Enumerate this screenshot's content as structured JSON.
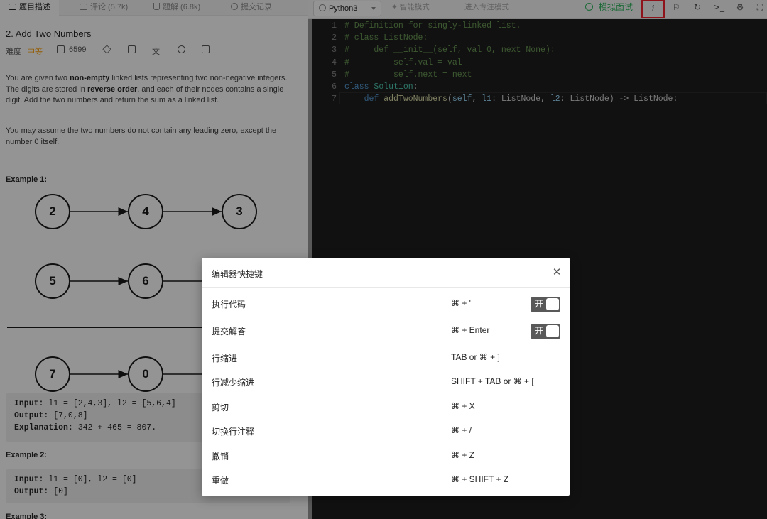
{
  "left_tabs": [
    {
      "label": "题目描述",
      "icon": "description-icon"
    },
    {
      "label": "评论 (5.7k)",
      "icon": "comment-icon"
    },
    {
      "label": "题解 (6.8k)",
      "icon": "flask-icon"
    },
    {
      "label": "提交记录",
      "icon": "history-icon"
    }
  ],
  "problem": {
    "title": "2. Add Two Numbers",
    "difficulty_label": "难度",
    "difficulty": "中等",
    "likes": "6599",
    "para1": {
      "t1": "You are given two ",
      "b1": "non-empty",
      "t2": " linked lists representing two non-negative integers. The digits are stored in ",
      "b2": "reverse order",
      "t3": ", and each of their nodes contains a single digit. Add the two numbers and return the sum as a linked list."
    },
    "para2": "You may assume the two numbers do not contain any leading zero, except the number 0 itself.",
    "example1_label": "Example 1:",
    "diagram_rows": [
      [
        "2",
        "4",
        "3"
      ],
      [
        "5",
        "6"
      ],
      [
        "7",
        "0"
      ]
    ],
    "example1": {
      "input_label": "Input:",
      "input_value": " l1 = [2,4,3], l2 = [5,6,4]",
      "output_label": "Output:",
      "output_value": " [7,0,8]",
      "explanation_label": "Explanation:",
      "explanation_value": " 342 + 465 = 807."
    },
    "example2_label": "Example 2:",
    "example2": {
      "input_label": "Input:",
      "input_value": " l1 = [0], l2 = [0]",
      "output_label": "Output:",
      "output_value": " [0]"
    },
    "example3_label": "Example 3:"
  },
  "toolbar": {
    "language": "Python3",
    "smart_mode": "智能模式",
    "focus_mode": "进入专注模式",
    "mock_interview": "模拟面试",
    "icons": [
      "info-icon",
      "flag-icon",
      "reset-icon",
      "console-icon",
      "settings-icon",
      "fullscreen-icon"
    ],
    "accent_color": "#2db55d",
    "highlight_color": "#f5222d"
  },
  "editor": {
    "line_numbers": [
      "1",
      "2",
      "3",
      "4",
      "5",
      "6",
      "7"
    ],
    "lines": [
      [
        {
          "t": "# Definition for singly-linked list.",
          "c": "com"
        }
      ],
      [
        {
          "t": "# class ListNode:",
          "c": "com"
        }
      ],
      [
        {
          "t": "#     def __init__(self, val=0, next=None):",
          "c": "com"
        }
      ],
      [
        {
          "t": "#         self.val = val",
          "c": "com"
        }
      ],
      [
        {
          "t": "#         self.next = next",
          "c": "com"
        }
      ],
      [
        {
          "t": "class ",
          "c": "kw"
        },
        {
          "t": "Solution",
          "c": "cls"
        },
        {
          "t": ":",
          "c": "txt"
        }
      ],
      [
        {
          "t": "    ",
          "c": "txt"
        },
        {
          "t": "def ",
          "c": "kw"
        },
        {
          "t": "addTwoNumbers",
          "c": "fn"
        },
        {
          "t": "(",
          "c": "txt"
        },
        {
          "t": "self",
          "c": "var"
        },
        {
          "t": ", ",
          "c": "txt"
        },
        {
          "t": "l1",
          "c": "var"
        },
        {
          "t": ": ListNode, ",
          "c": "txt"
        },
        {
          "t": "l2",
          "c": "var"
        },
        {
          "t": ": ListNode) -> ListNode:",
          "c": "txt"
        }
      ]
    ]
  },
  "modal": {
    "title": "编辑器快捷键",
    "close_icon": "close-icon",
    "shortcuts": [
      {
        "name": "执行代码",
        "keys": "⌘ + '",
        "toggle": "开"
      },
      {
        "name": "提交解答",
        "keys": "⌘ + Enter",
        "toggle": "开"
      },
      {
        "name": "行缩进",
        "keys": "TAB or ⌘ + ]"
      },
      {
        "name": "行减少缩进",
        "keys": "SHIFT + TAB or ⌘ + ["
      },
      {
        "name": "剪切",
        "keys": "⌘ + X"
      },
      {
        "name": "切换行注释",
        "keys": "⌘ + /"
      },
      {
        "name": "撤销",
        "keys": "⌘ + Z"
      },
      {
        "name": "重做",
        "keys": "⌘ + SHIFT + Z"
      }
    ]
  }
}
